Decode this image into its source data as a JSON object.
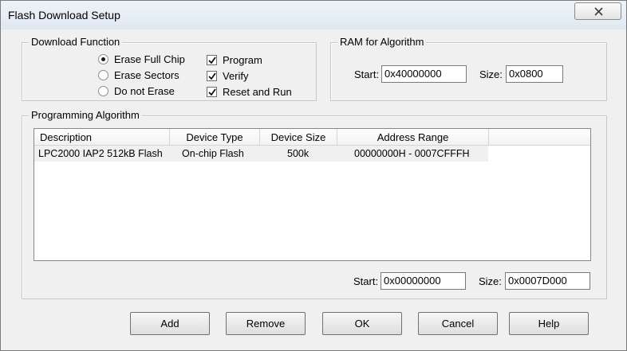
{
  "window": {
    "title": "Flash Download Setup"
  },
  "download_function": {
    "title": "Download Function",
    "radios": [
      {
        "label": "Erase Full Chip",
        "selected": true
      },
      {
        "label": "Erase Sectors",
        "selected": false
      },
      {
        "label": "Do not Erase",
        "selected": false
      }
    ],
    "checks": [
      {
        "label": "Program",
        "checked": true
      },
      {
        "label": "Verify",
        "checked": true
      },
      {
        "label": "Reset and Run",
        "checked": true
      }
    ]
  },
  "ram_for_algorithm": {
    "title": "RAM for Algorithm",
    "start_label": "Start:",
    "start_value": "0x40000000",
    "size_label": "Size:",
    "size_value": "0x0800"
  },
  "programming_algorithm": {
    "title": "Programming Algorithm",
    "columns": [
      "Description",
      "Device Type",
      "Device Size",
      "Address Range"
    ],
    "rows": [
      {
        "description": "LPC2000 IAP2 512kB Flash",
        "device_type": "On-chip Flash",
        "device_size": "500k",
        "address_range": "00000000H - 0007CFFFH"
      }
    ],
    "start_label": "Start:",
    "start_value": "0x00000000",
    "size_label": "Size:",
    "size_value": "0x0007D000"
  },
  "buttons": {
    "add": "Add",
    "remove": "Remove",
    "ok": "OK",
    "cancel": "Cancel",
    "help": "Help"
  },
  "colors": {
    "dialog_bg": "#f0f0f0",
    "selected_row_bg": "#f0f0f0"
  }
}
